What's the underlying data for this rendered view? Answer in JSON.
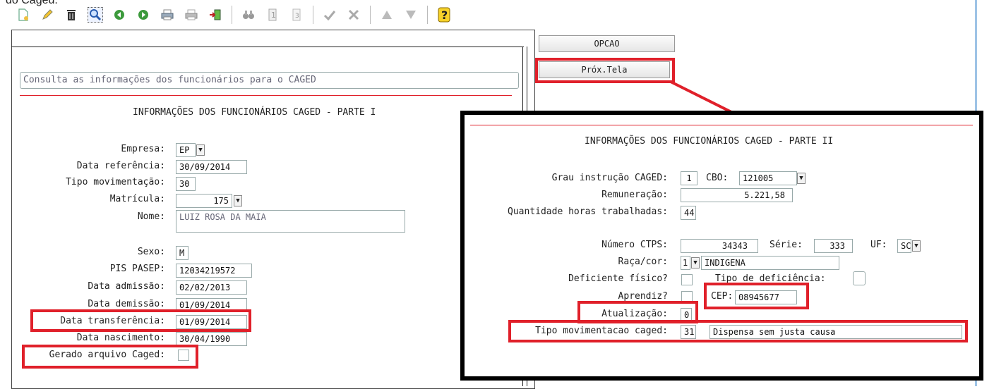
{
  "top_fragment": "do Caged.",
  "toolbar": {
    "icons": [
      "new-doc-icon",
      "edit-pencil-icon",
      "trash-icon",
      "search-icon",
      "prev-green-icon",
      "next-green-icon",
      "print-icon",
      "print-preview-icon",
      "exit-door-icon",
      "binoculars-icon",
      "report-one-icon",
      "report-three-icon",
      "checkmark-icon",
      "tools-icon",
      "triangle-up-icon",
      "triangle-down-icon",
      "help-icon"
    ]
  },
  "buttons": {
    "opcao": "OPCAO",
    "prox_tela": "Próx.Tela"
  },
  "left": {
    "description": "Consulta as informações dos funcionários para o CAGED",
    "section_title": "INFORMAÇÕES DOS FUNCIONÁRIOS CAGED - PARTE I",
    "fields": {
      "empresa": {
        "label": "Empresa:",
        "value": "EP"
      },
      "data_referencia": {
        "label": "Data referência:",
        "value": "30/09/2014"
      },
      "tipo_movimentacao": {
        "label": "Tipo movimentação:",
        "value": "30"
      },
      "matricula": {
        "label": "Matrícula:",
        "value": "175"
      },
      "nome": {
        "label": "Nome:",
        "value": "LUIZ ROSA DA MAIA"
      },
      "sexo": {
        "label": "Sexo:",
        "value": "M"
      },
      "pis_pasep": {
        "label": "PIS PASEP:",
        "value": "12034219572"
      },
      "data_admissao": {
        "label": "Data admissão:",
        "value": "02/02/2013"
      },
      "data_demissao": {
        "label": "Data demissão:",
        "value": "01/09/2014"
      },
      "data_transferencia": {
        "label": "Data transferência:",
        "value": "01/09/2014"
      },
      "data_nascimento": {
        "label": "Data nascimento:",
        "value": "30/04/1990"
      },
      "gerado_arquivo": {
        "label": "Gerado arquivo Caged:",
        "value": ""
      }
    }
  },
  "right": {
    "section_title": "INFORMAÇÕES DOS FUNCIONÁRIOS CAGED - PARTE II",
    "fields": {
      "grau_instrucao": {
        "label": "Grau instrução CAGED:",
        "value": "1"
      },
      "cbo": {
        "label": "CBO:",
        "value": "121005"
      },
      "remuneracao": {
        "label": "Remuneração:",
        "value": "5.221,58"
      },
      "horas": {
        "label": "Quantidade horas trabalhadas:",
        "value": "44"
      },
      "ctps": {
        "label": "Número CTPS:",
        "value": "34343"
      },
      "serie": {
        "label": "Série:",
        "value": "333"
      },
      "uf": {
        "label": "UF:",
        "value": "SC"
      },
      "raca_cor": {
        "label": "Raça/cor:",
        "code": "1",
        "value": "INDIGENA"
      },
      "deficiente": {
        "label": "Deficiente físico?"
      },
      "tipo_deficiencia": {
        "label": "Tipo de deficiência:"
      },
      "aprendiz": {
        "label": "Aprendiz?"
      },
      "cep": {
        "label": "CEP:",
        "value": "08945677"
      },
      "atualizacao": {
        "label": "Atualização:",
        "value": "0"
      },
      "tipo_mov_caged": {
        "label": "Tipo movimentacao caged:",
        "code": "31",
        "value": "Dispensa sem justa causa"
      }
    }
  },
  "colors": {
    "highlight": "#e0202a",
    "divider": "#e0202a"
  }
}
